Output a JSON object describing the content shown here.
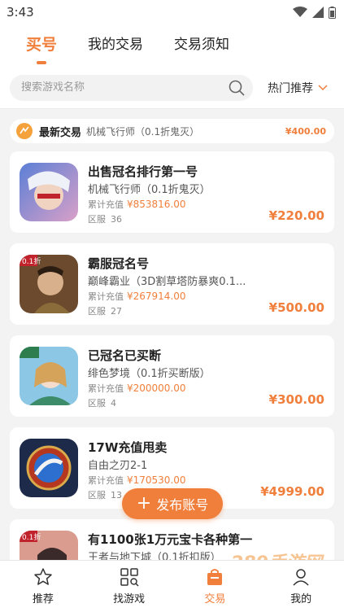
{
  "status_bar": {
    "time": "3:43"
  },
  "top_tabs": [
    {
      "label": "买号",
      "active": true
    },
    {
      "label": "我的交易",
      "active": false
    },
    {
      "label": "交易须知",
      "active": false
    }
  ],
  "search": {
    "placeholder": "搜索游戏名称",
    "sort_label": "热门推荐"
  },
  "latest": {
    "title": "最新交易",
    "desc": "机械飞行师（0.1折鬼灭）",
    "price": "¥400.00"
  },
  "listings": [
    {
      "title": "出售冠名排行第一号",
      "game": "机械飞行师（0.1折鬼灭）",
      "recharge_label": "累计充值",
      "recharge": "¥853816.00",
      "server_label": "区服",
      "server": "36",
      "price": "¥220.00"
    },
    {
      "title": "霸服冠名号",
      "game": "巅峰霸业（3D割草塔防暴爽0.1...",
      "recharge_label": "累计充值",
      "recharge": "¥267914.00",
      "server_label": "区服",
      "server": "27",
      "price": "¥500.00"
    },
    {
      "title": "已冠名已买断",
      "game": "绯色梦境（0.1折买断版）",
      "recharge_label": "累计充值",
      "recharge": "¥200000.00",
      "server_label": "区服",
      "server": "4",
      "price": "¥300.00"
    },
    {
      "title": "17W充值甩卖",
      "game": "自由之刃2-1",
      "recharge_label": "累计充值",
      "recharge": "¥170530.00",
      "server_label": "区服",
      "server": "13",
      "price": "¥4999.00"
    },
    {
      "title": "有1100张1万元宝卡各种第一",
      "game": "王者与地下城（0.1折扣版）",
      "recharge_label": "",
      "recharge": "",
      "server_label": "",
      "server": "",
      "price": ""
    }
  ],
  "fab": {
    "label": "发布账号"
  },
  "bottom_nav": [
    {
      "label": "推荐",
      "icon": "star-icon",
      "active": false
    },
    {
      "label": "找游戏",
      "icon": "grid-search-icon",
      "active": false
    },
    {
      "label": "交易",
      "icon": "trade-bag-icon",
      "active": true
    },
    {
      "label": "我的",
      "icon": "user-icon",
      "active": false
    }
  ],
  "watermark": "289手游网",
  "colors": {
    "accent": "#f07f3c",
    "background": "#f3f3f3"
  }
}
